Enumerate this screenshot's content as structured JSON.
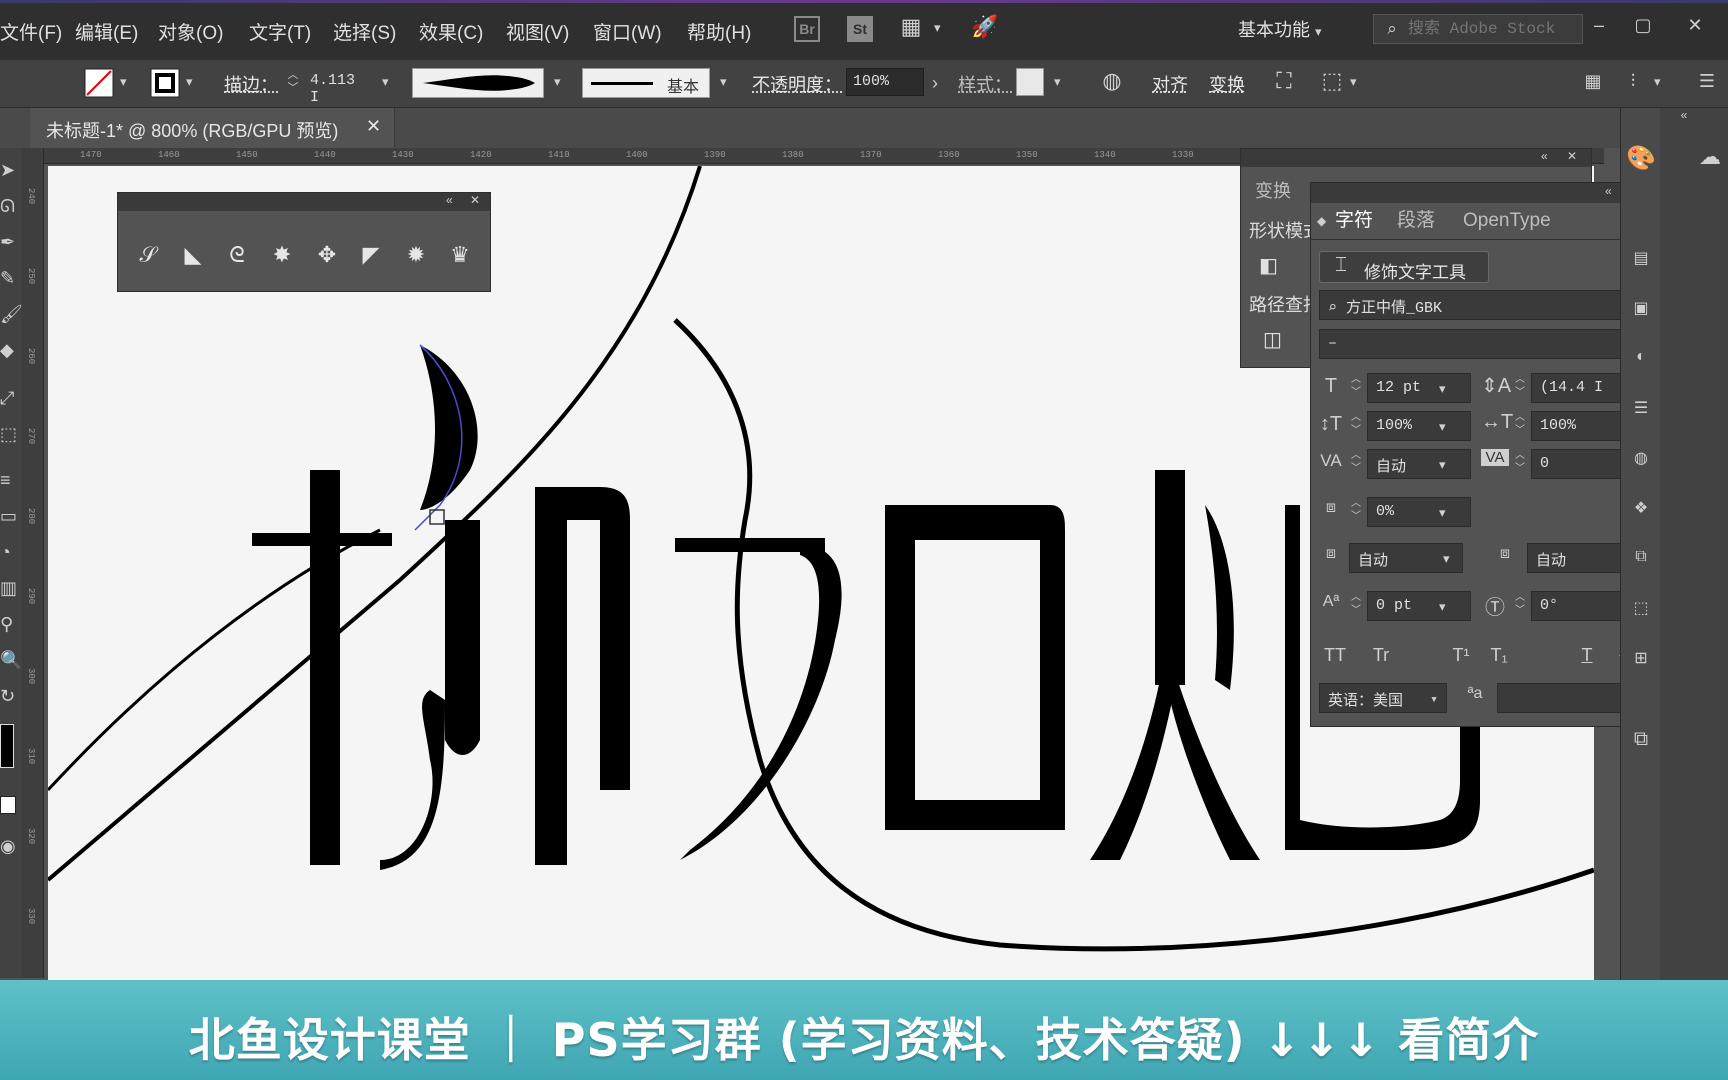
{
  "menu": {
    "items": [
      "文件(F)",
      "编辑(E)",
      "对象(O)",
      "文字(T)",
      "选择(S)",
      "效果(C)",
      "视图(V)",
      "窗口(W)",
      "帮助(H)"
    ],
    "bridge": "Br",
    "stock": "St",
    "workspace": "基本功能",
    "search_placeholder": "搜索 Adobe Stock"
  },
  "controlbar": {
    "stroke_label": "描边：",
    "stroke_value": "4.113 I",
    "brush_label": "基本",
    "opacity_label": "不透明度：",
    "opacity_value": "100%",
    "style_label": "样式：",
    "align_label": "对齐",
    "transform_label": "变换"
  },
  "document": {
    "tab_title": "未标题-1* @ 800% (RGB/GPU 预览)",
    "close": "✕",
    "ruler_top": [
      "1470",
      "1460",
      "1450",
      "1440",
      "1430",
      "1420",
      "1410",
      "1400",
      "1390",
      "1380",
      "1370",
      "1360",
      "1350",
      "1340",
      "1330"
    ],
    "ruler_left": [
      "240",
      "250",
      "260",
      "270",
      "280",
      "290",
      "300",
      "310",
      "320",
      "330"
    ]
  },
  "back_panel": {
    "tab": "变换",
    "shape_mode": "形状模式",
    "pathfinder": "路径查找器"
  },
  "character_panel": {
    "tabs": [
      "字符",
      "段落",
      "OpenType"
    ],
    "touch_type_tool": "修饰文字工具",
    "font_family": "方正中倩_GBK",
    "font_style": "–",
    "font_size": "12 pt",
    "leading": "(14.4 I",
    "vertical_scale": "100%",
    "horizontal_scale": "100%",
    "kerning": "自动",
    "tracking": "0",
    "tsume": "0%",
    "aki_left": "自动",
    "aki_right": "自动",
    "baseline_shift": "0 pt",
    "rotation": "0°",
    "language": "英语：美国"
  },
  "banner": {
    "text": "北鱼设计课堂 ｜ PS学习群 (学习资料、技术答疑) ↓↓↓ 看简介"
  },
  "colors": {
    "accent": "#5fc1c8",
    "ui_dark": "#2f2f2f",
    "panel": "#535353",
    "artboard": "#f5f5f5"
  }
}
